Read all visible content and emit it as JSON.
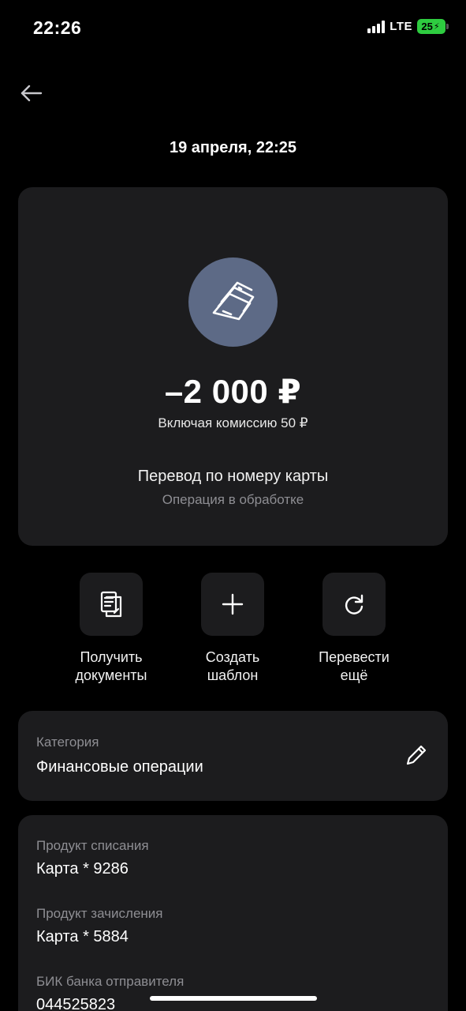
{
  "status_bar": {
    "time": "22:26",
    "network": "LTE",
    "battery": "25"
  },
  "header": {
    "back_icon": "arrow-left-icon",
    "date": "19 апреля, 22:25"
  },
  "operation": {
    "icon": "banknotes-icon",
    "icon_bg_color": "#5d6a86",
    "amount": "–2 000 ₽",
    "commission": "Включая комиссию  50 ₽",
    "title": "Перевод по номеру карты",
    "status": "Операция в обработке"
  },
  "actions": [
    {
      "icon": "document-icon",
      "line1": "Получить",
      "line2": "документы"
    },
    {
      "icon": "plus-icon",
      "line1": "Создать",
      "line2": "шаблон"
    },
    {
      "icon": "repeat-icon",
      "line1": "Перевести",
      "line2": "ещё"
    }
  ],
  "category": {
    "label": "Категория",
    "value": "Финансовые операции",
    "edit_icon": "pencil-icon"
  },
  "details": [
    {
      "label": "Продукт списания",
      "value": "Карта * 9286"
    },
    {
      "label": "Продукт зачисления",
      "value": "Карта * 5884"
    },
    {
      "label": "БИК банка отправителя",
      "value": "044525823"
    }
  ]
}
